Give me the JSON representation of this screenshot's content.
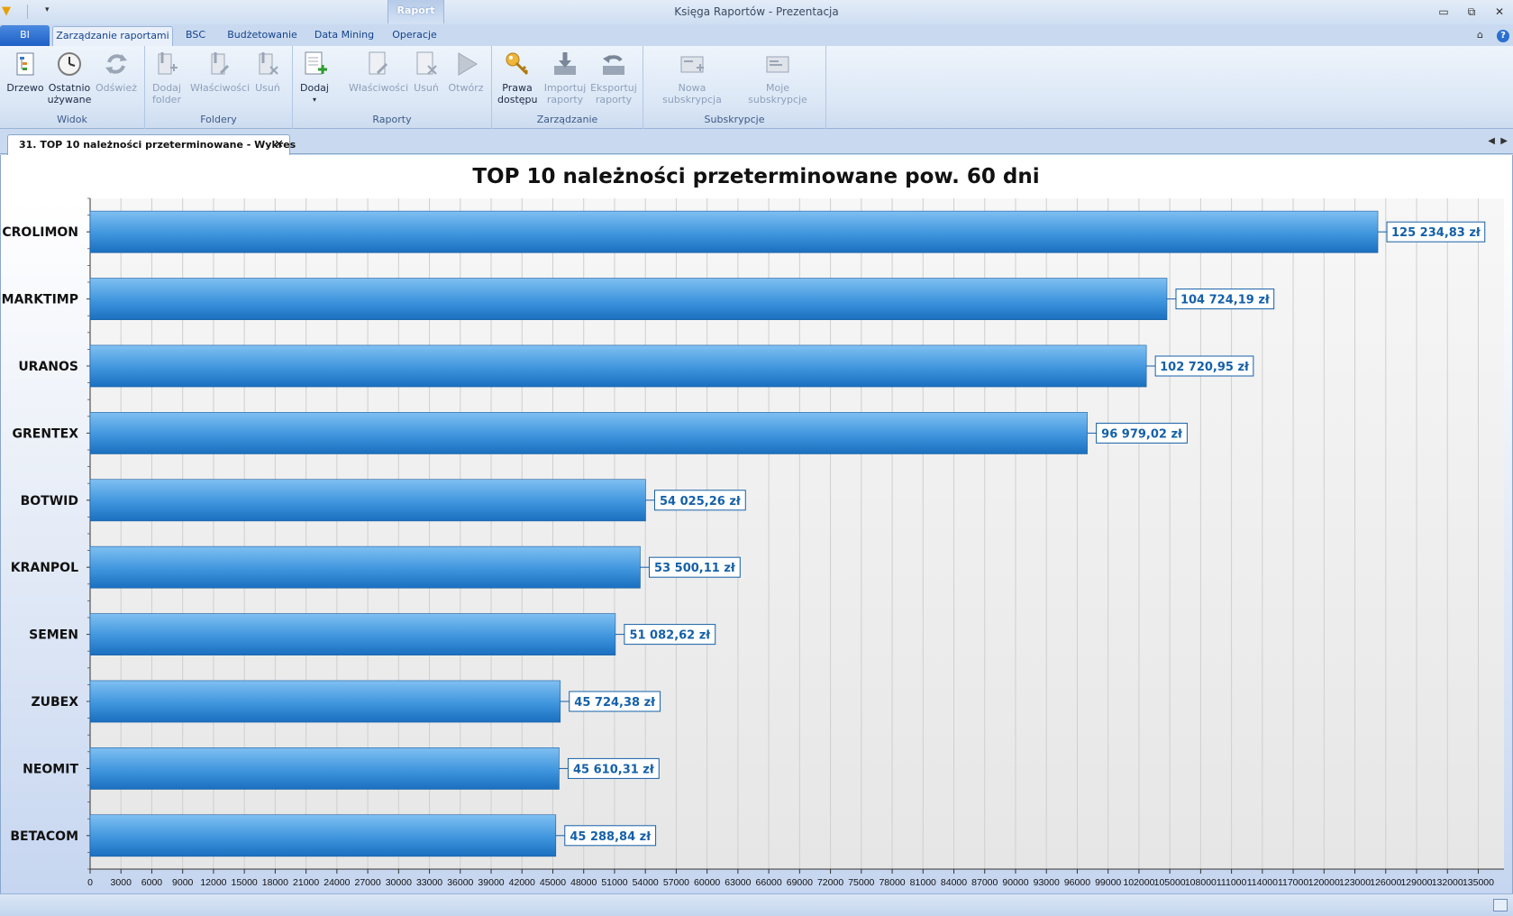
{
  "window": {
    "title": "Księga Raportów - Prezentacja",
    "context_tab": "Raport"
  },
  "ribbon_tabs": [
    "BI",
    "Zarządzanie raportami",
    "BSC",
    "Budżetowanie",
    "Data Mining",
    "Operacje"
  ],
  "ribbon": {
    "groups": [
      {
        "label": "Widok",
        "buttons": [
          {
            "label": "Drzewo",
            "icon": "tree-icon",
            "enabled": true
          },
          {
            "label": "Ostatnio\nużywane",
            "icon": "clock-icon",
            "enabled": true
          },
          {
            "label": "Odśwież",
            "icon": "refresh-icon",
            "enabled": false
          }
        ]
      },
      {
        "label": "Foldery",
        "buttons": [
          {
            "label": "Dodaj\nfolder",
            "icon": "add-folder-icon",
            "enabled": false
          },
          {
            "label": "Właściwości",
            "icon": "properties-icon",
            "enabled": false
          },
          {
            "label": "Usuń",
            "icon": "delete-icon",
            "enabled": false
          }
        ]
      },
      {
        "label": "Raporty",
        "buttons": [
          {
            "label": "Dodaj",
            "icon": "add-report-icon",
            "enabled": true,
            "dropdown": true
          },
          {
            "label": "Właściwości",
            "icon": "properties-icon",
            "enabled": false
          },
          {
            "label": "Usuń",
            "icon": "delete-icon",
            "enabled": false
          },
          {
            "label": "Otwórz",
            "icon": "play-icon",
            "enabled": false
          }
        ]
      },
      {
        "label": "Zarządzanie",
        "buttons": [
          {
            "label": "Prawa\ndostępu",
            "icon": "key-icon",
            "enabled": true
          },
          {
            "label": "Importuj\nraporty",
            "icon": "import-icon",
            "enabled": false
          },
          {
            "label": "Eksportuj\nraporty",
            "icon": "export-icon",
            "enabled": false
          }
        ]
      },
      {
        "label": "Subskrypcje",
        "buttons": [
          {
            "label": "Nowa subskrypcja",
            "icon": "new-subscription-icon",
            "enabled": false
          },
          {
            "label": "Moje subskrypcje",
            "icon": "my-subscriptions-icon",
            "enabled": false
          }
        ]
      }
    ]
  },
  "document_tab": {
    "label": "31. TOP 10 należności przeterminowane - Wykres"
  },
  "colors": {
    "bar_light": "#7fc0f2",
    "bar_dark": "#1a6fbf",
    "label_text": "#1560a8"
  },
  "chart_data": {
    "type": "bar",
    "orientation": "horizontal",
    "title": "TOP 10 należności przeterminowane pow. 60 dni",
    "categories": [
      "CROLIMON",
      "MARKTIMP",
      "URANOS",
      "GRENTEX",
      "BOTWID",
      "KRANPOL",
      "SEMEN",
      "ZUBEX",
      "NEOMIT",
      "BETACOM"
    ],
    "values": [
      125234.83,
      104724.19,
      102720.95,
      96979.02,
      54025.26,
      53500.11,
      51082.62,
      45724.38,
      45610.31,
      45288.84
    ],
    "value_labels": [
      "125 234,83 zł",
      "104 724,19 zł",
      "102 720,95 zł",
      "96 979,02 zł",
      "54 025,26 zł",
      "53 500,11 zł",
      "51 082,62 zł",
      "45 724,38 zł",
      "45 610,31 zł",
      "45 288,84 zł"
    ],
    "xlim": [
      0,
      137500
    ],
    "x_tick_step": 3000,
    "x_tick_labels": [
      "0",
      "3000",
      "6000",
      "9000",
      "12000",
      "15000",
      "18000",
      "21000",
      "24000",
      "27000",
      "30000",
      "33000",
      "36000",
      "39000",
      "42000",
      "45000",
      "48000",
      "51000",
      "54000",
      "57000",
      "60000",
      "63000",
      "66000",
      "69000",
      "72000",
      "75000",
      "78000",
      "81000",
      "84000",
      "87000",
      "90000",
      "93000",
      "96000",
      "99000",
      "102000",
      "105000",
      "108000",
      "111000",
      "114000",
      "117000",
      "120000",
      "123000",
      "126000",
      "129000",
      "132000",
      "135000"
    ],
    "grid": true,
    "legend": "none"
  }
}
